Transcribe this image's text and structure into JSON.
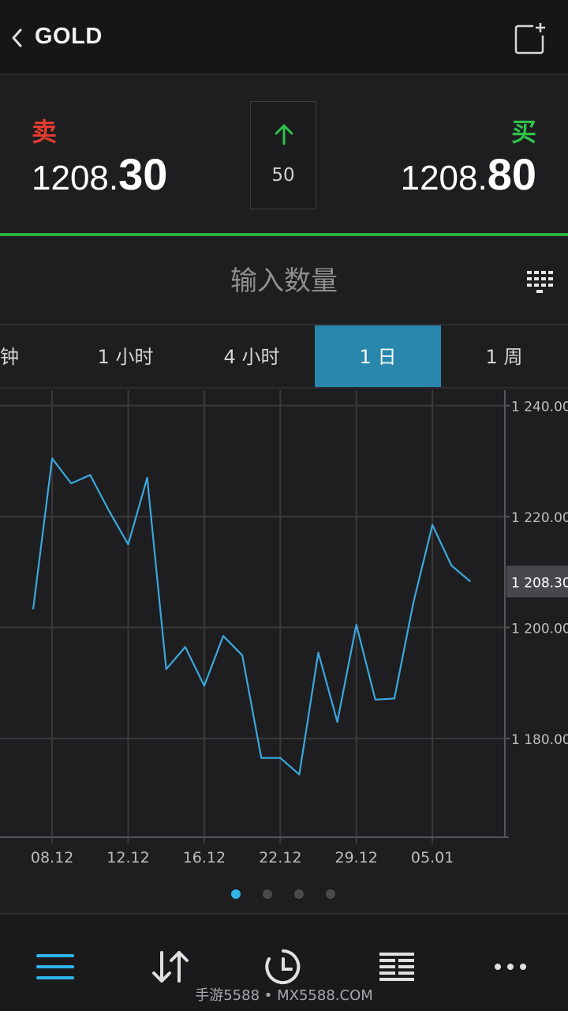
{
  "header": {
    "title": "GOLD"
  },
  "prices": {
    "sell_label": "卖",
    "sell_main": "1208.",
    "sell_big": "30",
    "buy_label": "买",
    "buy_main": "1208.",
    "buy_big": "80",
    "spread": "50",
    "up_color": "#2fc04a",
    "sell_color": "#e23b30",
    "buy_color": "#2fc04a"
  },
  "quantity": {
    "placeholder": "输入数量"
  },
  "tabs": [
    {
      "label": "分钟"
    },
    {
      "label": "1 小时"
    },
    {
      "label": "4 小时"
    },
    {
      "label": "1 日",
      "active": true
    },
    {
      "label": "1 周"
    }
  ],
  "chart_data": {
    "type": "line",
    "x_tick_labels": [
      "08.12",
      "12.12",
      "16.12",
      "22.12",
      "29.12",
      "05.01"
    ],
    "y_tick_labels": [
      "1 240.00",
      "1 220.00",
      "1 200.00",
      "1 180.00"
    ],
    "y_ticks": [
      1240,
      1220,
      1200,
      1180
    ],
    "ylim": [
      1162.2,
      1242.8
    ],
    "current_value_label": "1 208.30",
    "current_value": 1208.3,
    "grid": true,
    "line_color": "#3aa8dc",
    "series": [
      {
        "values": [
          1203.3,
          1230.5,
          1226.0,
          1227.5,
          1221.0,
          1215.0,
          1227.0,
          1192.5,
          1196.5,
          1189.5,
          1198.5,
          1195.0,
          1176.5,
          1176.5,
          1173.5,
          1195.5,
          1183.0,
          1200.5,
          1187.0,
          1187.2,
          1204.5,
          1218.5,
          1211.2,
          1208.3
        ]
      }
    ]
  },
  "pager": {
    "pages": 4,
    "active": 0
  },
  "bottom_nav": [
    {
      "name": "menu-icon"
    },
    {
      "name": "sort-arrows-icon"
    },
    {
      "name": "clock-icon"
    },
    {
      "name": "list-icon"
    },
    {
      "name": "more-icon"
    }
  ],
  "watermark": "手游5588 • MX5588.COM"
}
